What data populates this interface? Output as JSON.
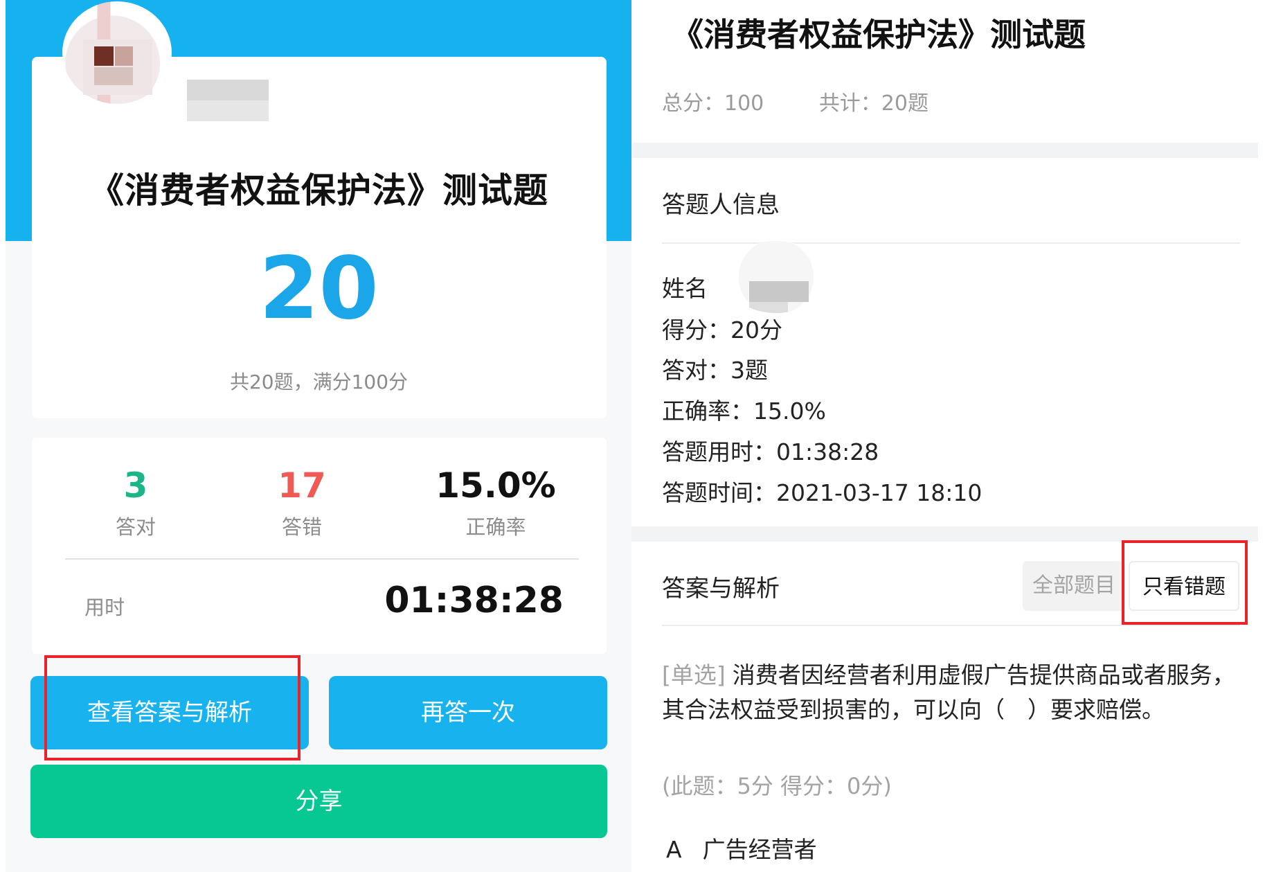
{
  "left": {
    "quiz_title": "《消费者权益保护法》测试题",
    "score": "20",
    "score_sub": "共20题，满分100分",
    "stats": {
      "correct_value": "3",
      "correct_label": "答对",
      "wrong_value": "17",
      "wrong_label": "答错",
      "rate_value": "15.0%",
      "rate_label": "正确率",
      "time_label": "用时",
      "time_value": "01:38:28"
    },
    "buttons": {
      "view_analysis": "查看答案与解析",
      "retry": "再答一次",
      "share": "分享"
    }
  },
  "right": {
    "quiz_title": "《消费者权益保护法》测试题",
    "total_score": "总分：100",
    "total_count": "共计：20题",
    "info_section_title": "答题人信息",
    "info": {
      "name": "姓名",
      "score": "得分：20分",
      "correct": "答对：3题",
      "rate": "正确率：15.0%",
      "duration": "答题用时：01:38:28",
      "time": "答题时间：2021-03-17 18:10"
    },
    "answers_section_title": "答案与解析",
    "filter_all": "全部题目",
    "filter_wrong": "只看错题",
    "question": {
      "type": "[单选]",
      "text": "消费者因经营者利用虚假广告提供商品或者服务，其合法权益受到损害的，可以向（　）要求赔偿。",
      "points": "(此题：5分 得分：0分)",
      "option_a_letter": "A",
      "option_a_text": "广告经营者"
    }
  },
  "colors": {
    "header_blue": "#16b1ef",
    "score_blue": "#1aa6e8",
    "correct_green": "#1cb58a",
    "wrong_red": "#ef5a55",
    "button_blue": "#18b2ef",
    "share_green": "#07c893",
    "highlight_red": "#e8232a"
  }
}
